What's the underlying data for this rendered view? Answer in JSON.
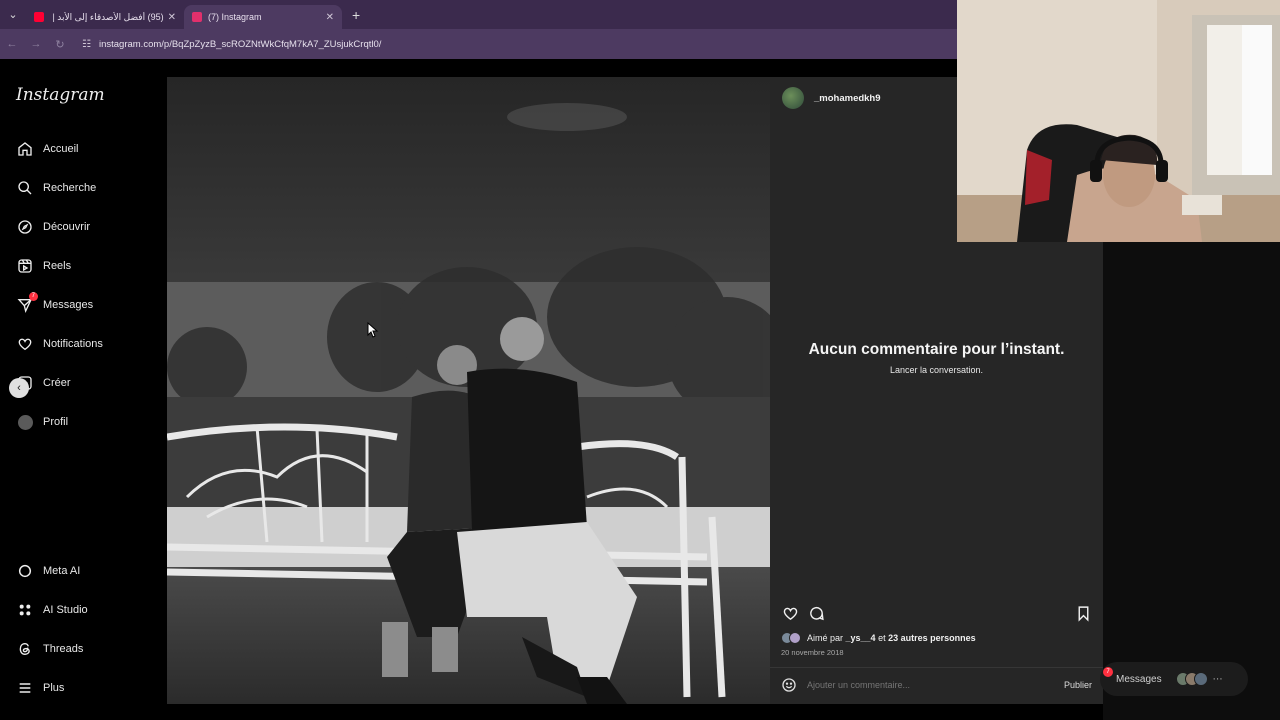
{
  "browser": {
    "tabs": [
      {
        "title": "(95) أفضل الأصدقاء إلى الأبد | كك",
        "active": false,
        "favicon_color": "#ff0033"
      },
      {
        "title": "(7) Instagram",
        "active": true,
        "favicon_color": "#e1306c"
      }
    ],
    "new_tab": "+",
    "url": "instagram.com/p/BqZpZyzB_scROZNtWkCfqM7kA7_ZUsjukCrqtl0/"
  },
  "sidebar": {
    "logo": "Instagram",
    "items": [
      {
        "label": "Accueil",
        "icon": "home-icon"
      },
      {
        "label": "Recherche",
        "icon": "search-icon"
      },
      {
        "label": "Découvrir",
        "icon": "compass-icon"
      },
      {
        "label": "Reels",
        "icon": "reels-icon"
      },
      {
        "label": "Messages",
        "icon": "messenger-icon",
        "badge": "7"
      },
      {
        "label": "Notifications",
        "icon": "heart-icon"
      },
      {
        "label": "Créer",
        "icon": "plus-square-icon"
      },
      {
        "label": "Profil",
        "icon": "avatar-icon"
      }
    ],
    "bottom_items": [
      {
        "label": "Meta AI",
        "icon": "meta-ai-icon"
      },
      {
        "label": "AI Studio",
        "icon": "ai-studio-icon"
      },
      {
        "label": "Threads",
        "icon": "threads-icon"
      },
      {
        "label": "Plus",
        "icon": "menu-icon"
      }
    ]
  },
  "post": {
    "author": "_mohamedkh9",
    "empty_title": "Aucun commentaire pour l’instant.",
    "empty_subtitle": "Lancer la conversation.",
    "likes_text_prefix": "Aimé par ",
    "likes_user": "_ys__4",
    "likes_text_suffix": " et ",
    "likes_others": "23 autres personnes",
    "date": "20 novembre 2018",
    "comment_placeholder": "Ajouter un commentaire...",
    "publish_label": "Publier"
  },
  "messages_pill": {
    "label": "Messages",
    "badge": "7"
  },
  "colors": {
    "chrome_tabbar": "#3b2a4d",
    "chrome_address": "#4d3a61",
    "panel_bg": "#262626",
    "badge_red": "#ff3040"
  }
}
